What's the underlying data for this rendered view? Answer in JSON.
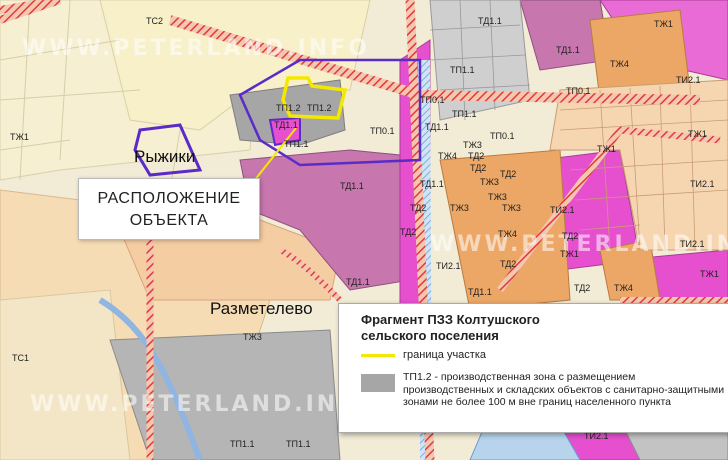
{
  "map": {
    "callout_lines": [
      "РАСПОЛОЖЕНИЕ",
      "ОБЪЕКТА"
    ],
    "places": {
      "ryzhiki": "Рыжики",
      "razmetelevo": "Разметелево"
    },
    "watermark": "WWW.PETERLAND.INFO",
    "zone_labels": [
      "ТС2",
      "ТП1.2",
      "ТП1.2",
      "ТД1.1",
      "ТП1.1",
      "ТП0.1",
      "ТД1.1",
      "ТД1.1",
      "ТП1.1",
      "ТД1.1",
      "ТП1.1",
      "ТП0.1",
      "ТП0.1",
      "ТЖ4",
      "ТД2",
      "ТЖ3",
      "ТЖ3",
      "ТД2",
      "ТЖ3",
      "ТЖ4",
      "ТД2",
      "ТИ2.1",
      "ТД2",
      "ТД1.1",
      "ТД2",
      "ТИ2.1",
      "ТД1.1",
      "ТЖ1",
      "ТЖ1",
      "ТЖ3",
      "ТС1",
      "ТП1.1",
      "ТП1.1",
      "ТИ2.1",
      "ТД2",
      "ТЖ4",
      "ТИ2.1",
      "ТД1.1",
      "ТЖ1",
      "ТЖ1",
      "ТИ2.1",
      "ТЖ3",
      "ТИ2.1",
      "ТЖ1",
      "ТЖ1",
      "ТД2",
      "ТЖ3",
      "ТД2",
      "ТЖ4",
      "ТП0.1",
      "ТД1.1"
    ],
    "legend": {
      "title_line1": "Фрагмент ПЗЗ Колтушского",
      "title_line2": "сельского поселения",
      "boundary_label": "граница участка",
      "zone_text": "ТП1.2 -  производственная зона с размещением производственных и складских объектов с санитарно-защитными зонами не более 100 м вне границ населенного пункта"
    },
    "colors": {
      "background": "#f2ecd6",
      "residential": "#f5cda3",
      "orange_residential": "#eca766",
      "business_violet": "#c777ad",
      "magenta": "#e650cf",
      "industrial_gray": "#a6a6a6",
      "road_red": "#e43838",
      "boundary_yellow": "#f5e800",
      "settlement_border": "#5a2bc7"
    }
  }
}
